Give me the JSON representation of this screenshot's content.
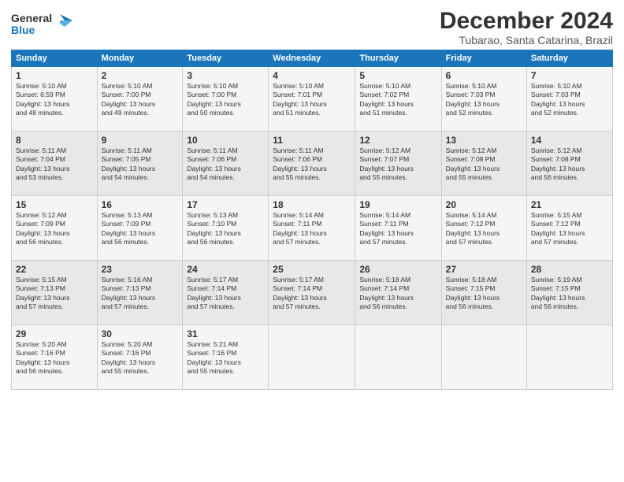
{
  "header": {
    "logo_line1": "General",
    "logo_line2": "Blue",
    "month": "December 2024",
    "location": "Tubarao, Santa Catarina, Brazil"
  },
  "weekdays": [
    "Sunday",
    "Monday",
    "Tuesday",
    "Wednesday",
    "Thursday",
    "Friday",
    "Saturday"
  ],
  "weeks": [
    [
      {
        "day": "1",
        "sunrise": "Sunrise: 5:10 AM",
        "sunset": "Sunset: 6:59 PM",
        "daylight": "Daylight: 13 hours and 48 minutes."
      },
      {
        "day": "2",
        "sunrise": "Sunrise: 5:10 AM",
        "sunset": "Sunset: 7:00 PM",
        "daylight": "Daylight: 13 hours and 49 minutes."
      },
      {
        "day": "3",
        "sunrise": "Sunrise: 5:10 AM",
        "sunset": "Sunset: 7:00 PM",
        "daylight": "Daylight: 13 hours and 50 minutes."
      },
      {
        "day": "4",
        "sunrise": "Sunrise: 5:10 AM",
        "sunset": "Sunset: 7:01 PM",
        "daylight": "Daylight: 13 hours and 51 minutes."
      },
      {
        "day": "5",
        "sunrise": "Sunrise: 5:10 AM",
        "sunset": "Sunset: 7:02 PM",
        "daylight": "Daylight: 13 hours and 51 minutes."
      },
      {
        "day": "6",
        "sunrise": "Sunrise: 5:10 AM",
        "sunset": "Sunset: 7:03 PM",
        "daylight": "Daylight: 13 hours and 52 minutes."
      },
      {
        "day": "7",
        "sunrise": "Sunrise: 5:10 AM",
        "sunset": "Sunset: 7:03 PM",
        "daylight": "Daylight: 13 hours and 52 minutes."
      }
    ],
    [
      {
        "day": "8",
        "sunrise": "Sunrise: 5:11 AM",
        "sunset": "Sunset: 7:04 PM",
        "daylight": "Daylight: 13 hours and 53 minutes."
      },
      {
        "day": "9",
        "sunrise": "Sunrise: 5:11 AM",
        "sunset": "Sunset: 7:05 PM",
        "daylight": "Daylight: 13 hours and 54 minutes."
      },
      {
        "day": "10",
        "sunrise": "Sunrise: 5:11 AM",
        "sunset": "Sunset: 7:06 PM",
        "daylight": "Daylight: 13 hours and 54 minutes."
      },
      {
        "day": "11",
        "sunrise": "Sunrise: 5:11 AM",
        "sunset": "Sunset: 7:06 PM",
        "daylight": "Daylight: 13 hours and 55 minutes."
      },
      {
        "day": "12",
        "sunrise": "Sunrise: 5:12 AM",
        "sunset": "Sunset: 7:07 PM",
        "daylight": "Daylight: 13 hours and 55 minutes."
      },
      {
        "day": "13",
        "sunrise": "Sunrise: 5:12 AM",
        "sunset": "Sunset: 7:08 PM",
        "daylight": "Daylight: 13 hours and 55 minutes."
      },
      {
        "day": "14",
        "sunrise": "Sunrise: 5:12 AM",
        "sunset": "Sunset: 7:08 PM",
        "daylight": "Daylight: 13 hours and 56 minutes."
      }
    ],
    [
      {
        "day": "15",
        "sunrise": "Sunrise: 5:12 AM",
        "sunset": "Sunset: 7:09 PM",
        "daylight": "Daylight: 13 hours and 56 minutes."
      },
      {
        "day": "16",
        "sunrise": "Sunrise: 5:13 AM",
        "sunset": "Sunset: 7:09 PM",
        "daylight": "Daylight: 13 hours and 56 minutes."
      },
      {
        "day": "17",
        "sunrise": "Sunrise: 5:13 AM",
        "sunset": "Sunset: 7:10 PM",
        "daylight": "Daylight: 13 hours and 56 minutes."
      },
      {
        "day": "18",
        "sunrise": "Sunrise: 5:14 AM",
        "sunset": "Sunset: 7:11 PM",
        "daylight": "Daylight: 13 hours and 57 minutes."
      },
      {
        "day": "19",
        "sunrise": "Sunrise: 5:14 AM",
        "sunset": "Sunset: 7:11 PM",
        "daylight": "Daylight: 13 hours and 57 minutes."
      },
      {
        "day": "20",
        "sunrise": "Sunrise: 5:14 AM",
        "sunset": "Sunset: 7:12 PM",
        "daylight": "Daylight: 13 hours and 57 minutes."
      },
      {
        "day": "21",
        "sunrise": "Sunrise: 5:15 AM",
        "sunset": "Sunset: 7:12 PM",
        "daylight": "Daylight: 13 hours and 57 minutes."
      }
    ],
    [
      {
        "day": "22",
        "sunrise": "Sunrise: 5:15 AM",
        "sunset": "Sunset: 7:13 PM",
        "daylight": "Daylight: 13 hours and 57 minutes."
      },
      {
        "day": "23",
        "sunrise": "Sunrise: 5:16 AM",
        "sunset": "Sunset: 7:13 PM",
        "daylight": "Daylight: 13 hours and 57 minutes."
      },
      {
        "day": "24",
        "sunrise": "Sunrise: 5:17 AM",
        "sunset": "Sunset: 7:14 PM",
        "daylight": "Daylight: 13 hours and 57 minutes."
      },
      {
        "day": "25",
        "sunrise": "Sunrise: 5:17 AM",
        "sunset": "Sunset: 7:14 PM",
        "daylight": "Daylight: 13 hours and 57 minutes."
      },
      {
        "day": "26",
        "sunrise": "Sunrise: 5:18 AM",
        "sunset": "Sunset: 7:14 PM",
        "daylight": "Daylight: 13 hours and 56 minutes."
      },
      {
        "day": "27",
        "sunrise": "Sunrise: 5:18 AM",
        "sunset": "Sunset: 7:15 PM",
        "daylight": "Daylight: 13 hours and 56 minutes."
      },
      {
        "day": "28",
        "sunrise": "Sunrise: 5:19 AM",
        "sunset": "Sunset: 7:15 PM",
        "daylight": "Daylight: 13 hours and 56 minutes."
      }
    ],
    [
      {
        "day": "29",
        "sunrise": "Sunrise: 5:20 AM",
        "sunset": "Sunset: 7:16 PM",
        "daylight": "Daylight: 13 hours and 56 minutes."
      },
      {
        "day": "30",
        "sunrise": "Sunrise: 5:20 AM",
        "sunset": "Sunset: 7:16 PM",
        "daylight": "Daylight: 13 hours and 55 minutes."
      },
      {
        "day": "31",
        "sunrise": "Sunrise: 5:21 AM",
        "sunset": "Sunset: 7:16 PM",
        "daylight": "Daylight: 13 hours and 55 minutes."
      },
      null,
      null,
      null,
      null
    ]
  ]
}
